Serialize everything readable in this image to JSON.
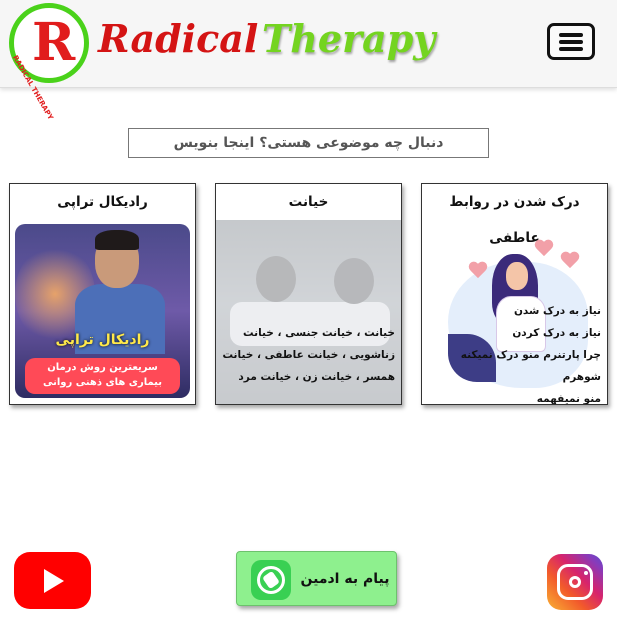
{
  "header": {
    "logo_letter": "R",
    "logo_ring_text": "RADICAL THERAPY",
    "brand_word_1": "Radical",
    "brand_word_2": "Therapy",
    "menu_icon": "hamburger-icon"
  },
  "search": {
    "placeholder": "دنبال چه موضوعی هستی؟ اینجا بنویس"
  },
  "cards": [
    {
      "title": "درک شدن در روابط عاطفی",
      "lines": [
        "نیاز به درک شدن",
        "نیاز به درک کردن",
        "چرا پارتنرم منو درک نمیکنه شوهرم",
        "منو نمیفهمه"
      ]
    },
    {
      "title": "خیانت",
      "lines": [
        "خیانت ، خیانت جنسی ، خیانت",
        "زناشویی ، خیانت عاطفی ، خیانت",
        "همسر ، خیانت زن ، خیانت مرد"
      ]
    },
    {
      "title": "رادیکال تراپی",
      "promo_title": "رادیکال تراپی",
      "promo_line_1": "سریعترین روش درمان",
      "promo_line_2": "بیماری های ذهنی روانی"
    }
  ],
  "footer": {
    "youtube_icon": "youtube-icon",
    "admin_label": "پیام به ادمین",
    "whatsapp_icon": "whatsapp-icon",
    "instagram_icon": "instagram-icon"
  },
  "colors": {
    "brand_red": "#d41414",
    "brand_green": "#74d420",
    "admin_button": "#8ef08e",
    "youtube_red": "#ff0000"
  }
}
